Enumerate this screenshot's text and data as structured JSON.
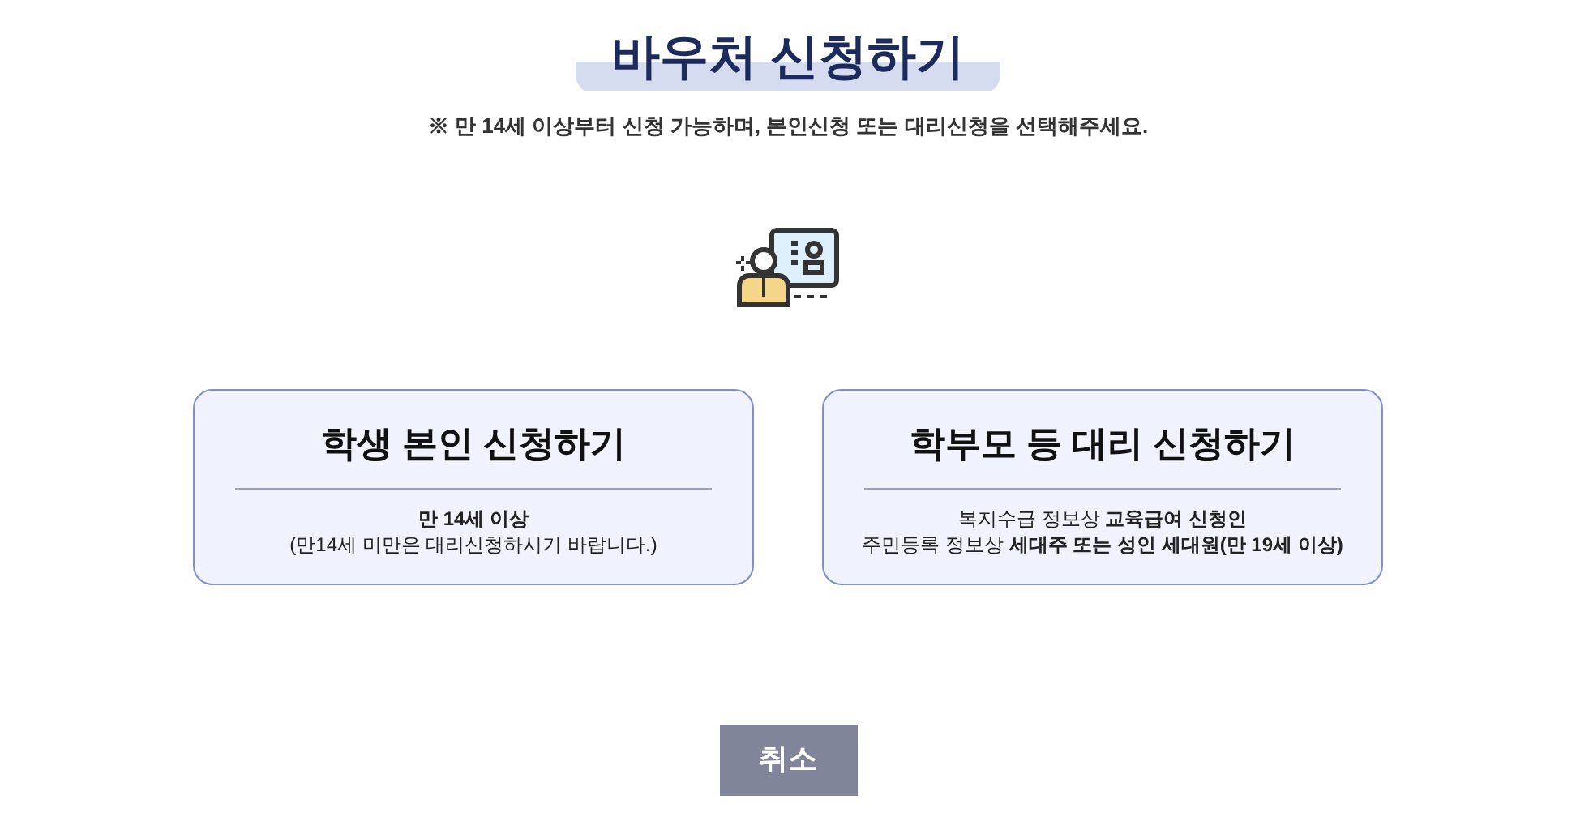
{
  "title": "바우처 신청하기",
  "notice": "※ 만 14세 이상부터 신청 가능하며, 본인신청 또는 대리신청을 선택해주세요.",
  "options": [
    {
      "title": "학생 본인 신청하기",
      "lines": [
        "**만 14세 이상**",
        "(만14세 미만은 대리신청하시기 바랍니다.)"
      ]
    },
    {
      "title": "학부모 등 대리 신청하기",
      "lines": [
        "복지수급 정보상 **교육급여 신청인**",
        "주민등록 정보상 **세대주 또는 성인 세대원(만 19세 이상)**"
      ]
    }
  ],
  "cancel_button": "취소"
}
